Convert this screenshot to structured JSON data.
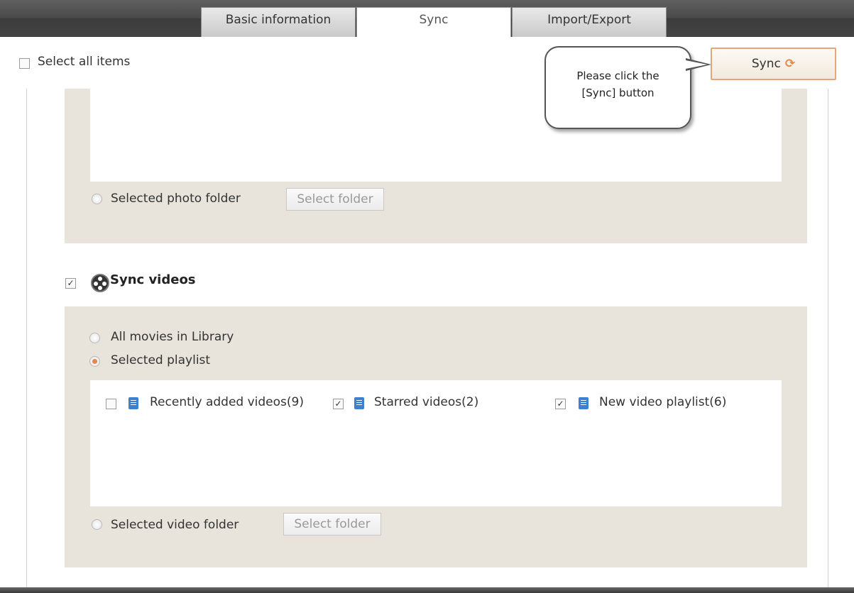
{
  "tabs": [
    {
      "label": "Basic information",
      "active": false
    },
    {
      "label": "Sync",
      "active": true
    },
    {
      "label": "Import/Export",
      "active": false
    }
  ],
  "header": {
    "select_all_label": "Select all items",
    "select_all_checked": false,
    "sync_button_label": "Sync",
    "sync_icon": "sync-arrows-icon"
  },
  "callout": {
    "line1": "Please click the",
    "line2": "[Sync] button"
  },
  "photos": {
    "selected_folder_label": "Selected photo folder",
    "select_folder_button": "Select folder"
  },
  "videos": {
    "section_title": "Sync videos",
    "section_checked": true,
    "option_all": "All movies in Library",
    "option_playlist": "Selected playlist",
    "selected_option": "Selected playlist",
    "playlists": [
      {
        "label": "Recently added videos(9)",
        "checked": false
      },
      {
        "label": "Starred videos(2)",
        "checked": true
      },
      {
        "label": "New video playlist(6)",
        "checked": true
      }
    ],
    "selected_folder_label": "Selected video folder",
    "select_folder_button": "Select folder"
  },
  "colors": {
    "accent": "#e3874b",
    "panel_bg": "#e8e4dc",
    "playlist_icon": "#3d7fd0"
  }
}
